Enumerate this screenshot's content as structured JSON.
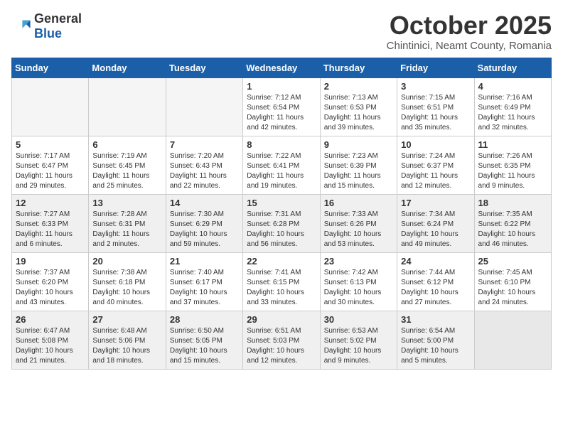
{
  "header": {
    "logo_general": "General",
    "logo_blue": "Blue",
    "title": "October 2025",
    "subtitle": "Chintinici, Neamt County, Romania"
  },
  "weekdays": [
    "Sunday",
    "Monday",
    "Tuesday",
    "Wednesday",
    "Thursday",
    "Friday",
    "Saturday"
  ],
  "weeks": [
    {
      "shaded": false,
      "days": [
        {
          "number": "",
          "detail": ""
        },
        {
          "number": "",
          "detail": ""
        },
        {
          "number": "",
          "detail": ""
        },
        {
          "number": "1",
          "detail": "Sunrise: 7:12 AM\nSunset: 6:54 PM\nDaylight: 11 hours\nand 42 minutes."
        },
        {
          "number": "2",
          "detail": "Sunrise: 7:13 AM\nSunset: 6:53 PM\nDaylight: 11 hours\nand 39 minutes."
        },
        {
          "number": "3",
          "detail": "Sunrise: 7:15 AM\nSunset: 6:51 PM\nDaylight: 11 hours\nand 35 minutes."
        },
        {
          "number": "4",
          "detail": "Sunrise: 7:16 AM\nSunset: 6:49 PM\nDaylight: 11 hours\nand 32 minutes."
        }
      ]
    },
    {
      "shaded": false,
      "days": [
        {
          "number": "5",
          "detail": "Sunrise: 7:17 AM\nSunset: 6:47 PM\nDaylight: 11 hours\nand 29 minutes."
        },
        {
          "number": "6",
          "detail": "Sunrise: 7:19 AM\nSunset: 6:45 PM\nDaylight: 11 hours\nand 25 minutes."
        },
        {
          "number": "7",
          "detail": "Sunrise: 7:20 AM\nSunset: 6:43 PM\nDaylight: 11 hours\nand 22 minutes."
        },
        {
          "number": "8",
          "detail": "Sunrise: 7:22 AM\nSunset: 6:41 PM\nDaylight: 11 hours\nand 19 minutes."
        },
        {
          "number": "9",
          "detail": "Sunrise: 7:23 AM\nSunset: 6:39 PM\nDaylight: 11 hours\nand 15 minutes."
        },
        {
          "number": "10",
          "detail": "Sunrise: 7:24 AM\nSunset: 6:37 PM\nDaylight: 11 hours\nand 12 minutes."
        },
        {
          "number": "11",
          "detail": "Sunrise: 7:26 AM\nSunset: 6:35 PM\nDaylight: 11 hours\nand 9 minutes."
        }
      ]
    },
    {
      "shaded": true,
      "days": [
        {
          "number": "12",
          "detail": "Sunrise: 7:27 AM\nSunset: 6:33 PM\nDaylight: 11 hours\nand 6 minutes."
        },
        {
          "number": "13",
          "detail": "Sunrise: 7:28 AM\nSunset: 6:31 PM\nDaylight: 11 hours\nand 2 minutes."
        },
        {
          "number": "14",
          "detail": "Sunrise: 7:30 AM\nSunset: 6:29 PM\nDaylight: 10 hours\nand 59 minutes."
        },
        {
          "number": "15",
          "detail": "Sunrise: 7:31 AM\nSunset: 6:28 PM\nDaylight: 10 hours\nand 56 minutes."
        },
        {
          "number": "16",
          "detail": "Sunrise: 7:33 AM\nSunset: 6:26 PM\nDaylight: 10 hours\nand 53 minutes."
        },
        {
          "number": "17",
          "detail": "Sunrise: 7:34 AM\nSunset: 6:24 PM\nDaylight: 10 hours\nand 49 minutes."
        },
        {
          "number": "18",
          "detail": "Sunrise: 7:35 AM\nSunset: 6:22 PM\nDaylight: 10 hours\nand 46 minutes."
        }
      ]
    },
    {
      "shaded": false,
      "days": [
        {
          "number": "19",
          "detail": "Sunrise: 7:37 AM\nSunset: 6:20 PM\nDaylight: 10 hours\nand 43 minutes."
        },
        {
          "number": "20",
          "detail": "Sunrise: 7:38 AM\nSunset: 6:18 PM\nDaylight: 10 hours\nand 40 minutes."
        },
        {
          "number": "21",
          "detail": "Sunrise: 7:40 AM\nSunset: 6:17 PM\nDaylight: 10 hours\nand 37 minutes."
        },
        {
          "number": "22",
          "detail": "Sunrise: 7:41 AM\nSunset: 6:15 PM\nDaylight: 10 hours\nand 33 minutes."
        },
        {
          "number": "23",
          "detail": "Sunrise: 7:42 AM\nSunset: 6:13 PM\nDaylight: 10 hours\nand 30 minutes."
        },
        {
          "number": "24",
          "detail": "Sunrise: 7:44 AM\nSunset: 6:12 PM\nDaylight: 10 hours\nand 27 minutes."
        },
        {
          "number": "25",
          "detail": "Sunrise: 7:45 AM\nSunset: 6:10 PM\nDaylight: 10 hours\nand 24 minutes."
        }
      ]
    },
    {
      "shaded": true,
      "days": [
        {
          "number": "26",
          "detail": "Sunrise: 6:47 AM\nSunset: 5:08 PM\nDaylight: 10 hours\nand 21 minutes."
        },
        {
          "number": "27",
          "detail": "Sunrise: 6:48 AM\nSunset: 5:06 PM\nDaylight: 10 hours\nand 18 minutes."
        },
        {
          "number": "28",
          "detail": "Sunrise: 6:50 AM\nSunset: 5:05 PM\nDaylight: 10 hours\nand 15 minutes."
        },
        {
          "number": "29",
          "detail": "Sunrise: 6:51 AM\nSunset: 5:03 PM\nDaylight: 10 hours\nand 12 minutes."
        },
        {
          "number": "30",
          "detail": "Sunrise: 6:53 AM\nSunset: 5:02 PM\nDaylight: 10 hours\nand 9 minutes."
        },
        {
          "number": "31",
          "detail": "Sunrise: 6:54 AM\nSunset: 5:00 PM\nDaylight: 10 hours\nand 5 minutes."
        },
        {
          "number": "",
          "detail": ""
        }
      ]
    }
  ]
}
